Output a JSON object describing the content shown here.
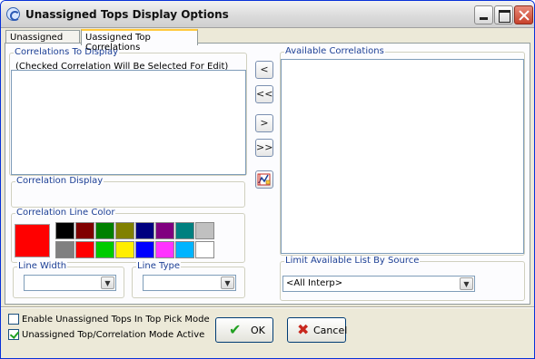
{
  "window": {
    "title": "Unassigned Tops Display Options"
  },
  "tabs": [
    {
      "label": "Unassigned Tops",
      "active": false
    },
    {
      "label": "Uassigned Top Correlations",
      "active": true
    }
  ],
  "left": {
    "correlations_group": "Correlations To Display",
    "correlations_hint": "(Checked Correlation Will Be Selected For Edit)",
    "display_group": "Correlation Display",
    "line_color_group": "Correlation Line Color",
    "selected_color": "#ff0000",
    "palette": [
      "#000000",
      "#800000",
      "#008000",
      "#808000",
      "#000080",
      "#800080",
      "#008080",
      "#c0c0c0",
      "#808080",
      "#ff0000",
      "#00cc00",
      "#ffee00",
      "#0000ff",
      "#ff33ff",
      "#00b4ff",
      "#ffffff"
    ],
    "line_width_group": "Line Width",
    "line_width_value": "",
    "line_type_group": "Line Type",
    "line_type_value": ""
  },
  "middle_buttons": {
    "add_one": "<",
    "add_all": "<<",
    "remove_one": ">",
    "remove_all": ">>",
    "properties_icon": "chart-edit-icon"
  },
  "right": {
    "available_group": "Available Correlations",
    "limit_group": "Limit Available List By Source",
    "limit_value": "<All Interp>"
  },
  "footer": {
    "enable_pick_label": "Enable Unassigned Tops In Top Pick Mode",
    "enable_pick_checked": false,
    "mode_active_label": "Unassigned Top/Correlation Mode Active",
    "mode_active_checked": true,
    "ok_label": "OK",
    "cancel_label": "Cancel"
  },
  "colors": {
    "accent": "#1c3f95",
    "ok_check": "#21a121",
    "cancel_x": "#c8281e"
  }
}
